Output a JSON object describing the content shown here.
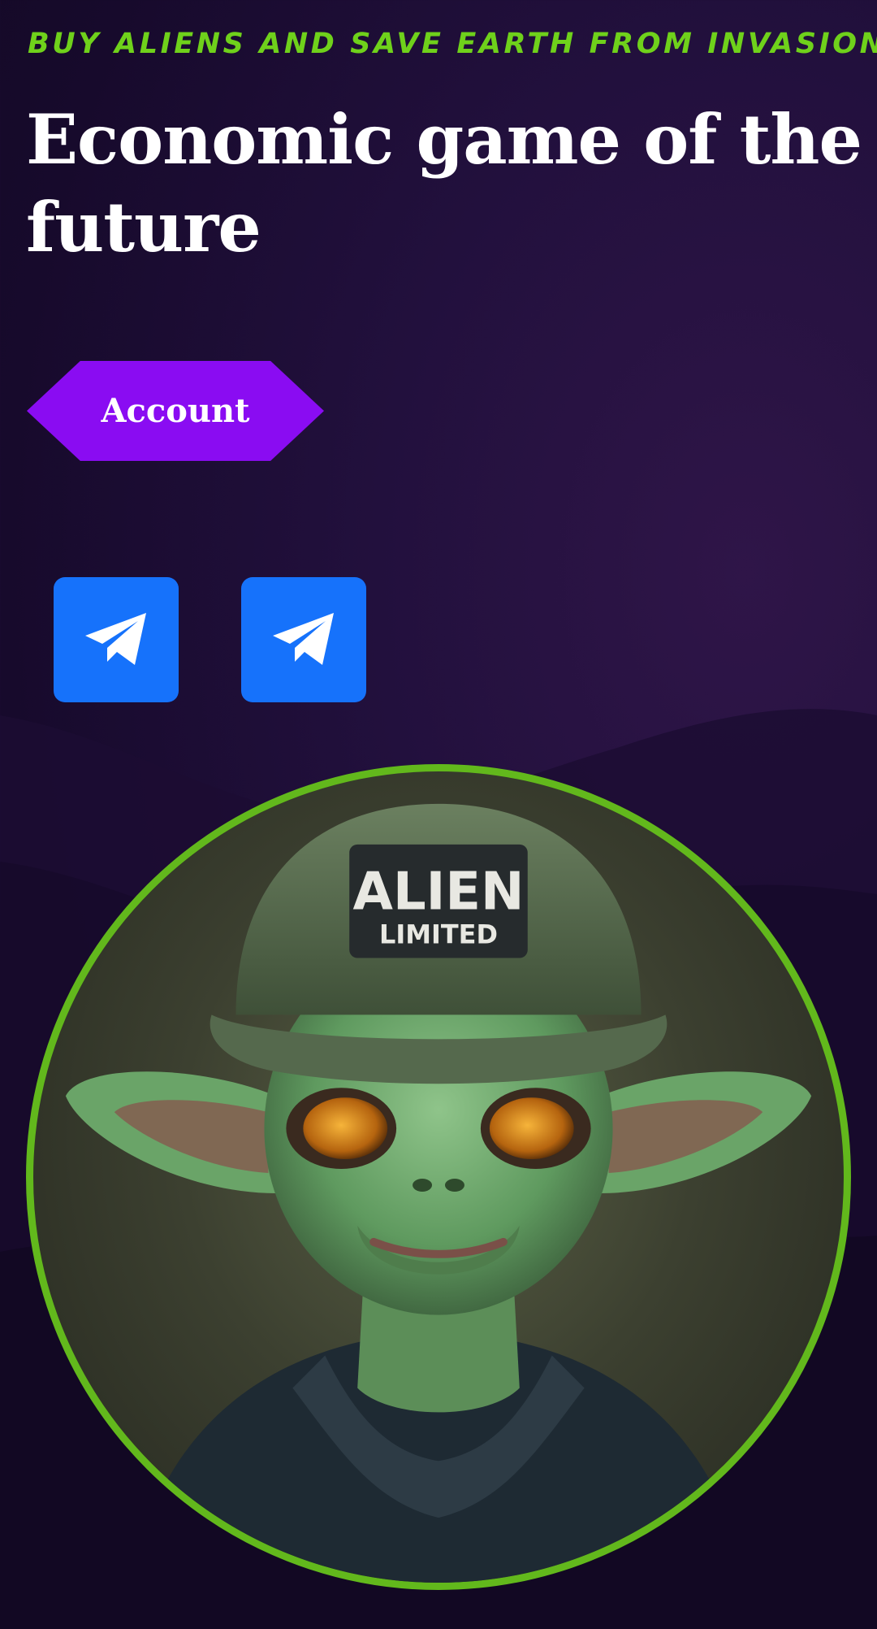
{
  "hero": {
    "tagline": "BUY ALIENS AND SAVE EARTH FROM INVASION",
    "headline": "Economic game of the future",
    "account_label": "Account"
  },
  "social": {
    "buttons": [
      {
        "icon": "telegram-icon"
      },
      {
        "icon": "telegram-icon"
      }
    ]
  },
  "avatar": {
    "cap_text_line1": "ALIEN",
    "cap_text_line2": "LIMITED"
  },
  "colors": {
    "background": "#1b0c30",
    "accent_green": "#6fd11b",
    "button_purple": "#8a0cf2",
    "telegram_blue": "#1672fb",
    "ring_green": "#62b81c"
  }
}
